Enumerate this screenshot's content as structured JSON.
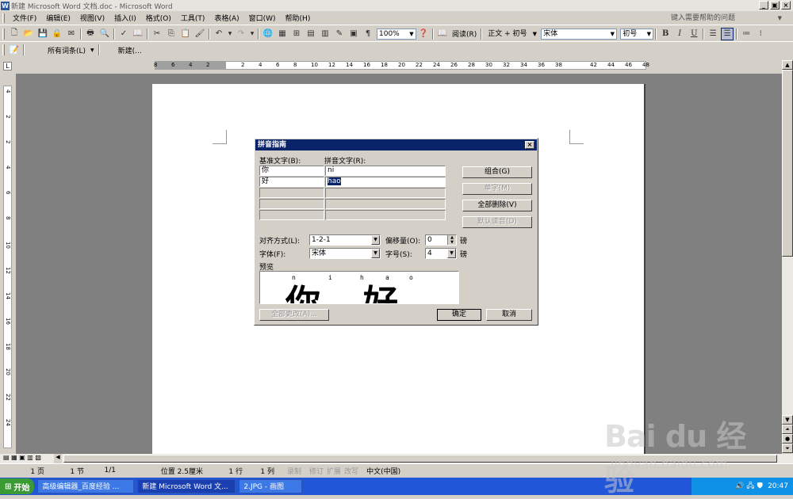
{
  "window": {
    "title": "新建 Microsoft Word 文档.doc - Microsoft Word",
    "help_placeholder": "键入需要帮助的问题",
    "min": "_",
    "max": "▣",
    "close": "×"
  },
  "menu": [
    "文件(F)",
    "编辑(E)",
    "视图(V)",
    "插入(I)",
    "格式(O)",
    "工具(T)",
    "表格(A)",
    "窗口(W)",
    "帮助(H)"
  ],
  "toolbar": {
    "zoom": "100%",
    "read_label": "阅读(R)",
    "style": "正文 + 初号",
    "font": "宋体",
    "size": "初号",
    "bold": "B",
    "italic": "I"
  },
  "toolbar2": {
    "all_entries": "所有词条(L)",
    "new_label": "新建(..."
  },
  "ruler": {
    "numbers": [
      "8",
      "6",
      "4",
      "2",
      "",
      "2",
      "4",
      "6",
      "8",
      "10",
      "12",
      "14",
      "16",
      "18",
      "20",
      "22",
      "24",
      "26",
      "28",
      "30",
      "32",
      "34",
      "36",
      "38",
      "",
      "42",
      "44",
      "46",
      "48"
    ],
    "vnumbers": [
      "4",
      "2",
      "2",
      "4",
      "6",
      "8",
      "10",
      "12",
      "14",
      "16",
      "18",
      "20",
      "22",
      "24"
    ]
  },
  "dialog": {
    "title": "拼音指南",
    "close": "×",
    "base_label": "基准文字(B):",
    "ruby_label": "拼音文字(R):",
    "rows": [
      {
        "base": "你",
        "ruby": "ni"
      },
      {
        "base": "好",
        "ruby": "hao"
      },
      {
        "base": "",
        "ruby": ""
      },
      {
        "base": "",
        "ruby": ""
      },
      {
        "base": "",
        "ruby": ""
      }
    ],
    "buttons": {
      "group": "组合(G)",
      "mono": "单字(M)",
      "clear_all": "全部删除(V)",
      "default": "默认读音(D)",
      "change_all": "全部更改(A)...",
      "ok": "确定",
      "cancel": "取消"
    },
    "align_label": "对齐方式(L):",
    "align_value": "1-2-1",
    "offset_label": "偏移量(O):",
    "offset_value": "0",
    "offset_unit": "磅",
    "font_label": "字体(F):",
    "font_value": "宋体",
    "size_label": "字号(S):",
    "size_value": "4",
    "size_unit": "磅",
    "preview_label": "预览",
    "preview_pinyin": [
      "n",
      "i",
      "h",
      "a",
      "o"
    ],
    "preview_chars": [
      "你",
      "好"
    ]
  },
  "status": {
    "page": "1 页",
    "section": "1 节",
    "pages": "1/1",
    "position": "位置 2.5厘米",
    "line": "1 行",
    "col": "1 列",
    "rec": "录制",
    "trk": "修订",
    "ext": "扩展",
    "ovr": "改写",
    "lang": "中文(中国)"
  },
  "taskbar": {
    "start": "开始",
    "tasks": [
      "高级编辑器_百度经验 ...",
      "新建 Microsoft Word 文...",
      "2.JPG - 画图"
    ],
    "time": "20:47"
  },
  "watermark": {
    "text": "Bai du 经验",
    "sub": "jingyan.baidu.com"
  },
  "colors": {
    "chrome": "#d4d0c8",
    "dialog_title": "#0a246a",
    "taskbar": "#2156d8",
    "start": "#3a9a33"
  }
}
